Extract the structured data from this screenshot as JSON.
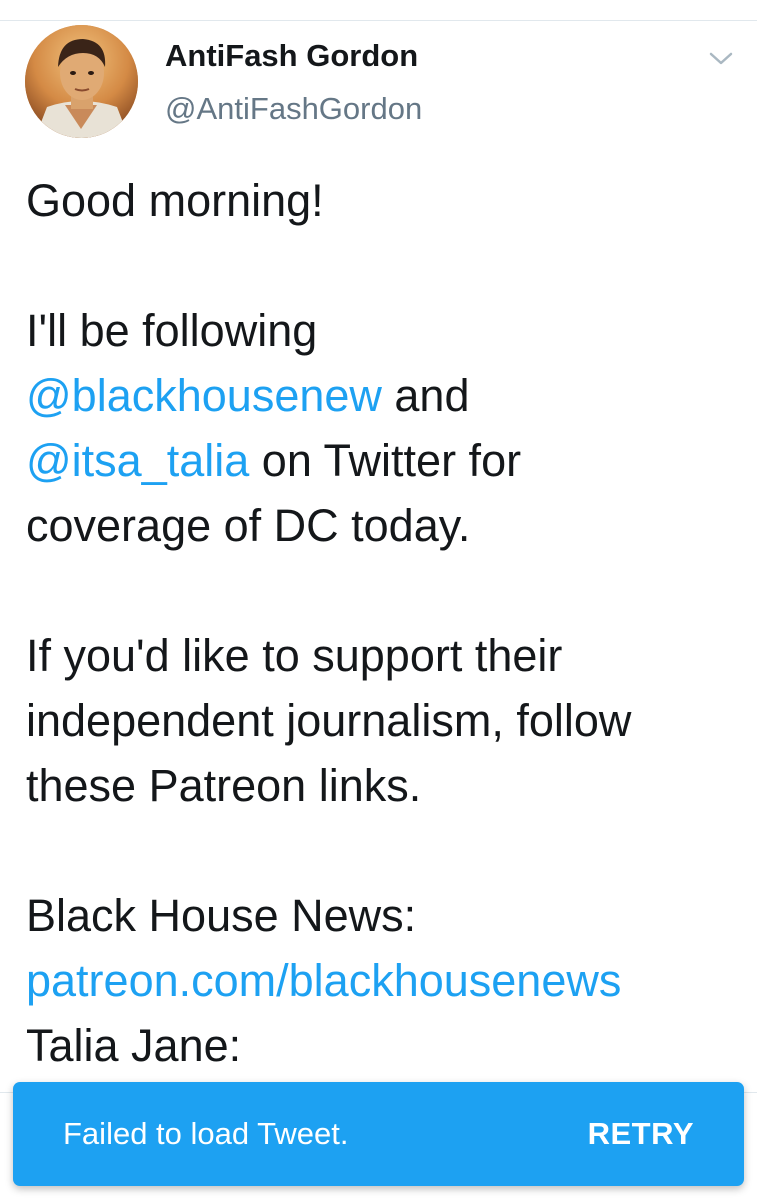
{
  "tweet": {
    "author": {
      "display_name": "AntiFash Gordon",
      "handle": "@AntiFashGordon"
    },
    "menu_icon": "chevron-down-icon",
    "body": {
      "greeting": "Good morning!",
      "p1_line1": "I'll be following",
      "mention1": "@blackhousenew",
      "p1_and": " and",
      "mention2": "@itsa_talia",
      "p1_line3_rest": " on Twitter for",
      "p1_line4": "coverage of DC today.",
      "p2_line1": "If you'd like to support their",
      "p2_line2": "independent journalism, follow",
      "p2_line3": "these Patreon links.",
      "p3_line1": "Black House News:",
      "p3_link": "patreon.com/blackhousenews",
      "p3_line3": "Talia Jane:"
    }
  },
  "toast": {
    "message": "Failed to load Tweet.",
    "action": "RETRY"
  },
  "colors": {
    "link": "#1da1f2",
    "toast_bg": "#1da1f2",
    "text": "#14171a",
    "muted": "#657786"
  }
}
